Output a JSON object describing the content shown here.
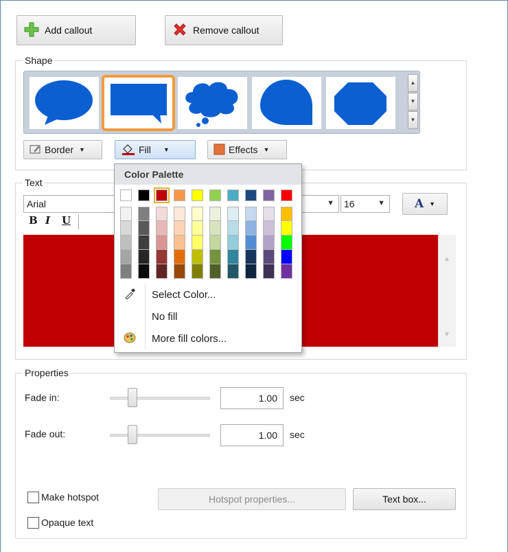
{
  "toolbar": {
    "add_label": "Add callout",
    "remove_label": "Remove callout"
  },
  "shape": {
    "legend": "Shape",
    "selected_index": 1
  },
  "style_buttons": {
    "border": "Border",
    "fill": "Fill",
    "effects": "Effects"
  },
  "text": {
    "legend": "Text",
    "font": "Arial",
    "size": "16",
    "fill_color": "#c00000",
    "format": {
      "bold": "B",
      "italic": "I",
      "underline": "U"
    }
  },
  "properties": {
    "legend": "Properties",
    "fade_in_label": "Fade in:",
    "fade_in_value": "1.00",
    "fade_in_unit": "sec",
    "fade_out_label": "Fade out:",
    "fade_out_value": "1.00",
    "fade_out_unit": "sec",
    "make_hotspot": "Make hotspot",
    "hotspot_properties": "Hotspot properties...",
    "text_box": "Text box...",
    "opaque_text": "Opaque text"
  },
  "popup": {
    "title": "Color Palette",
    "items": [
      "Select Color...",
      "No fill",
      "More fill colors..."
    ],
    "selected_color": "#c00000",
    "top_colors": [
      "#000000",
      "#c00000",
      "#f79646",
      "#ffff00",
      "#92d050",
      "#4bacc6",
      "#1f497d",
      "#8064a2",
      "#ff0000"
    ],
    "columns": [
      [
        "#f2f2f2",
        "#d8d8d8",
        "#bfbfbf",
        "#a5a5a5",
        "#7f7f7f"
      ],
      [
        "#7f7f7f",
        "#595959",
        "#3f3f3f",
        "#262626",
        "#0c0c0c"
      ],
      [
        "#f2dcdb",
        "#e6b9b8",
        "#d99694",
        "#953735",
        "#632523"
      ],
      [
        "#fde9d9",
        "#fbd5b5",
        "#fac08f",
        "#e46c0a",
        "#984807"
      ],
      [
        "#ffffcc",
        "#ffff99",
        "#ffff66",
        "#bfbf00",
        "#7f7f00"
      ],
      [
        "#ebf1dd",
        "#d7e4bd",
        "#c3d69b",
        "#76923c",
        "#4f6128"
      ],
      [
        "#dbeef3",
        "#b7dde8",
        "#92cddc",
        "#31859c",
        "#205867"
      ],
      [
        "#c6d9f0",
        "#8db3e2",
        "#548dd4",
        "#17365d",
        "#0f243e"
      ],
      [
        "#e5e0ec",
        "#ccc1d9",
        "#b2a2c7",
        "#5f497a",
        "#3f3151"
      ],
      [
        "#ffc000",
        "#ffff00",
        "#00ff00",
        "#0000ff",
        "#7030a0"
      ]
    ]
  },
  "colors": {
    "accent": "#f29a3c",
    "shape_blue": "#0b5fd1"
  }
}
